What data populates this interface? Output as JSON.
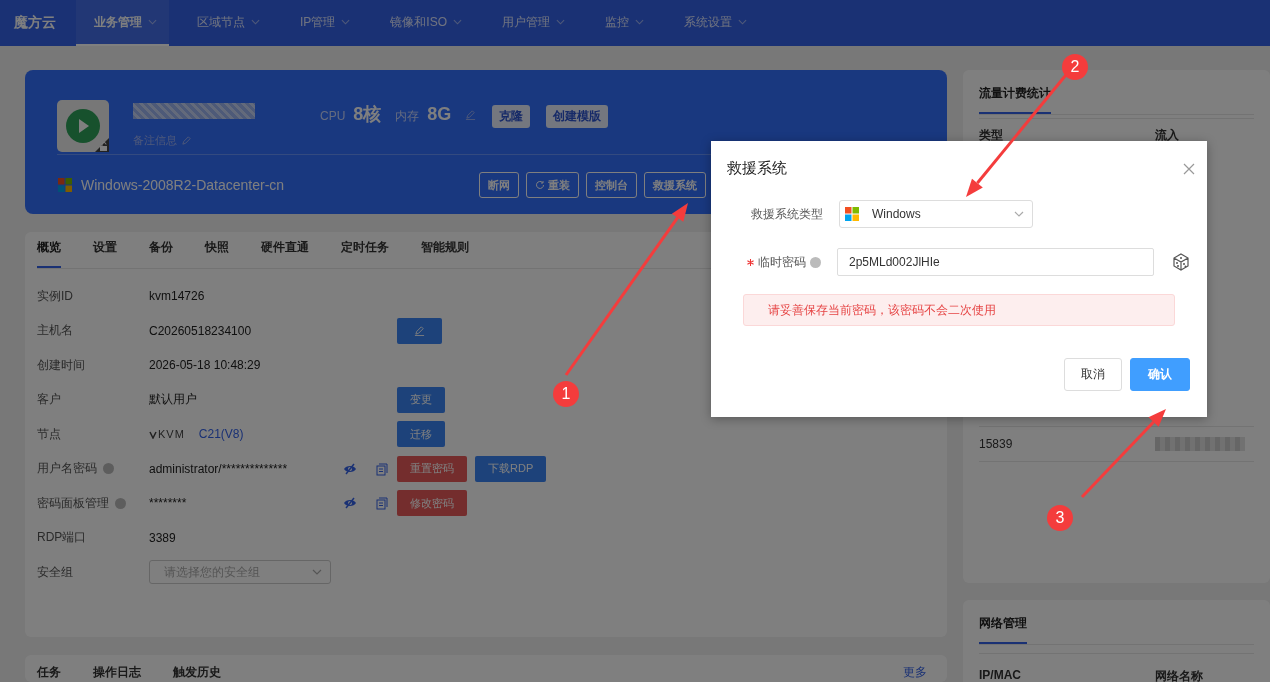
{
  "nav": {
    "logo": "魔方云",
    "items": [
      {
        "label": "业务管理",
        "selected": true
      },
      {
        "label": "区域节点",
        "selected": false
      },
      {
        "label": "IP管理",
        "selected": false
      },
      {
        "label": "镜像和ISO",
        "selected": false
      },
      {
        "label": "用户管理",
        "selected": false
      },
      {
        "label": "监控",
        "selected": false
      },
      {
        "label": "系统设置",
        "selected": false
      }
    ]
  },
  "instance": {
    "remark": "备注信息",
    "cpu_label": "CPU",
    "cpu": "8核",
    "mem_label": "内存",
    "mem": "8G",
    "top_buttons": [
      "克隆",
      "创建模版"
    ],
    "os": "Windows-2008R2-Datacenter-cn",
    "actions": [
      {
        "label": "断网",
        "kind": "text"
      },
      {
        "label": "重装",
        "kind": "icon_text"
      },
      {
        "label": "控制台",
        "kind": "text"
      },
      {
        "label": "救援系统",
        "kind": "text"
      }
    ]
  },
  "detail": {
    "tabs": [
      {
        "label": "概览",
        "selected": true
      },
      {
        "label": "设置",
        "selected": false
      },
      {
        "label": "备份",
        "selected": false
      },
      {
        "label": "快照",
        "selected": false
      },
      {
        "label": "硬件直通",
        "selected": false
      },
      {
        "label": "定时任务",
        "selected": false
      },
      {
        "label": "智能规则",
        "selected": false
      }
    ],
    "rows": [
      {
        "kind": "text",
        "label": "实例ID",
        "help": false,
        "value": "kvm14726"
      },
      {
        "kind": "text",
        "label": "主机名",
        "help": false,
        "value": "C20260518234100",
        "buttons": [
          {
            "kind": "edit",
            "color": "#1d427a"
          }
        ]
      },
      {
        "kind": "text",
        "label": "创建时间",
        "help": false,
        "value": "2026-05-18 10:48:29"
      },
      {
        "kind": "text",
        "label": "客户",
        "help": false,
        "value": "默认用户",
        "buttons": [
          {
            "kind": "text",
            "label": "变更",
            "color": "#1d427a"
          }
        ]
      },
      {
        "kind": "node",
        "label": "节点",
        "help": false,
        "value": "KVM",
        "link": "C21(V8)",
        "buttons": [
          {
            "kind": "text",
            "label": "迁移",
            "color": "#1d427a"
          }
        ]
      },
      {
        "kind": "secret",
        "label": "用户名密码",
        "help": true,
        "value": "administrator/**************",
        "buttons": [
          {
            "kind": "text",
            "label": "重置密码",
            "color": "#742d2d"
          },
          {
            "kind": "text",
            "label": "下载RDP",
            "color": "#1d427a"
          }
        ]
      },
      {
        "kind": "secret",
        "label": "密码面板管理",
        "help": true,
        "value": "********",
        "buttons": [
          {
            "kind": "text",
            "label": "修改密码",
            "color": "#742d2d"
          }
        ]
      },
      {
        "kind": "text",
        "label": "RDP端口",
        "help": false,
        "value": "3389"
      },
      {
        "kind": "select",
        "label": "安全组",
        "help": false,
        "placeholder": "请选择您的安全组"
      }
    ]
  },
  "logs": {
    "tabs": [
      "任务",
      "操作日志",
      "触发历史"
    ],
    "more": "更多"
  },
  "traffic": {
    "tab": "流量计费统计",
    "columns": [
      "类型",
      "流入"
    ],
    "rows": [
      {
        "cells": [
          "15839"
        ],
        "redacted": true
      }
    ]
  },
  "network": {
    "tab": "网络管理",
    "columns": [
      "IP/MAC",
      "网络名称"
    ]
  },
  "dialog": {
    "title": "救援系统",
    "fields": [
      {
        "kind": "select",
        "label": "救援系统类型",
        "required": false,
        "help": false,
        "value": "Windows"
      },
      {
        "kind": "input",
        "label": "临时密码",
        "required": true,
        "help": true,
        "value": "2p5MLd002JlHIe"
      }
    ],
    "alert": "请妥善保存当前密码，该密码不会二次使用",
    "buttons": [
      {
        "label": "取消",
        "primary": false
      },
      {
        "label": "确认",
        "primary": true
      }
    ]
  },
  "annotations": [
    {
      "number": "1"
    },
    {
      "number": "2"
    },
    {
      "number": "3"
    }
  ]
}
